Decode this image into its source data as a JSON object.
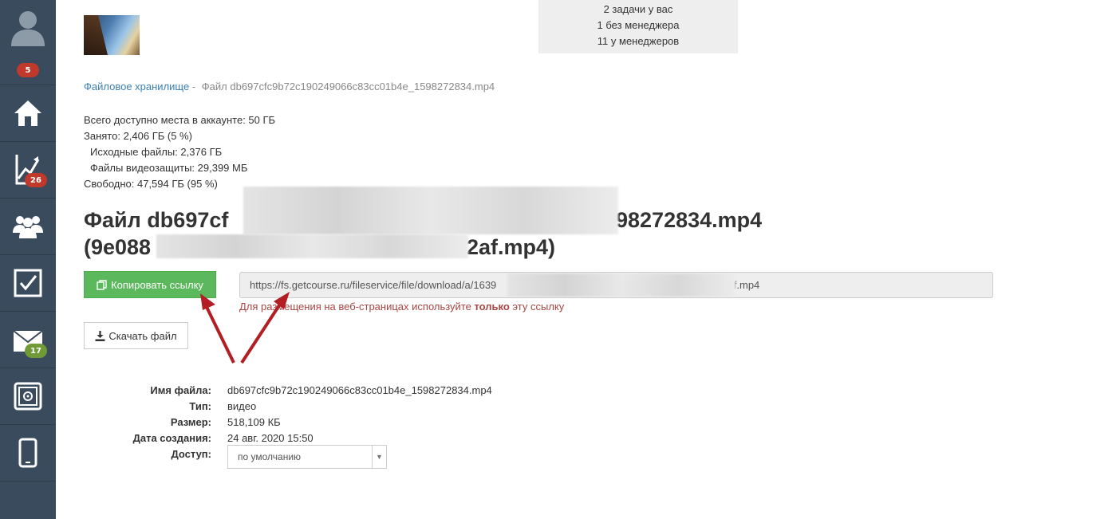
{
  "sidebar": {
    "profile_badge": "5",
    "stats_badge": "26",
    "mail_badge": "17",
    "icons": [
      "user-icon",
      "home-icon",
      "chart-icon",
      "users-icon",
      "tasks-icon",
      "mail-icon",
      "safe-icon",
      "mobile-icon"
    ]
  },
  "tasks": {
    "line1": "2 задачи у вас",
    "line2": "1 без менеджера",
    "line3": "11 у менеджеров"
  },
  "breadcrumb": {
    "root": "Файловое хранилище",
    "separator": "-",
    "current": "Файл db697cfc9b72c190249066c83cc01b4e_1598272834.mp4"
  },
  "storage": {
    "total": "Всего доступно места в аккаунте: 50 ГБ",
    "used": "Занято: 2,406 ГБ (5 %)",
    "source": "Исходные файлы: 2,376 ГБ",
    "protection": "Файлы видеозащиты: 29,399 МБ",
    "free": "Свободно: 47,594 ГБ (95 %)"
  },
  "title": {
    "line1_start": "Файл db697cf",
    "line1_end": "98272834.mp4",
    "line2_start": "(9e088",
    "line2_end": "2af.mp4)"
  },
  "buttons": {
    "copy_link": "Копировать ссылку",
    "download": "Скачать файл"
  },
  "url": {
    "start": "https://fs.getcourse.ru/fileservice/file/download/a/1639",
    "end": "af.mp4",
    "note_before": "Для размещения на веб-страницах используйте ",
    "note_bold": "только",
    "note_after": " эту ссылку"
  },
  "properties": {
    "name_label": "Имя файла:",
    "name_value": "db697cfc9b72c190249066c83cc01b4e_1598272834.mp4",
    "type_label": "Тип:",
    "type_value": "видео",
    "size_label": "Размер:",
    "size_value": "518,109 КБ",
    "date_label": "Дата создания:",
    "date_value": "24 авг. 2020 15:50",
    "access_label": "Доступ:",
    "access_value": "по умолчанию"
  },
  "colors": {
    "sidebar": "#3a4b5d",
    "badge_red": "#c0392b",
    "badge_green": "#6f9a37",
    "copy_button": "#5cb85c",
    "arrow": "#b21e23",
    "link": "#3a7fb5",
    "note": "#a94442"
  }
}
